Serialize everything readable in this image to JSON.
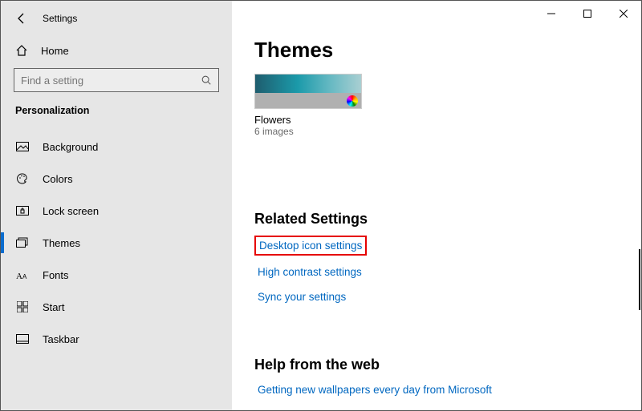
{
  "app": {
    "title": "Settings"
  },
  "home_label": "Home",
  "search": {
    "placeholder": "Find a setting"
  },
  "section_label": "Personalization",
  "nav": [
    {
      "label": "Background"
    },
    {
      "label": "Colors"
    },
    {
      "label": "Lock screen"
    },
    {
      "label": "Themes",
      "selected": true
    },
    {
      "label": "Fonts"
    },
    {
      "label": "Start"
    },
    {
      "label": "Taskbar"
    }
  ],
  "page": {
    "title": "Themes"
  },
  "theme": {
    "name": "Flowers",
    "subtitle": "6 images"
  },
  "related": {
    "heading": "Related Settings",
    "links": [
      "Desktop icon settings",
      "High contrast settings",
      "Sync your settings"
    ]
  },
  "help": {
    "heading": "Help from the web",
    "links": [
      "Getting new wallpapers every day from Microsoft"
    ]
  }
}
